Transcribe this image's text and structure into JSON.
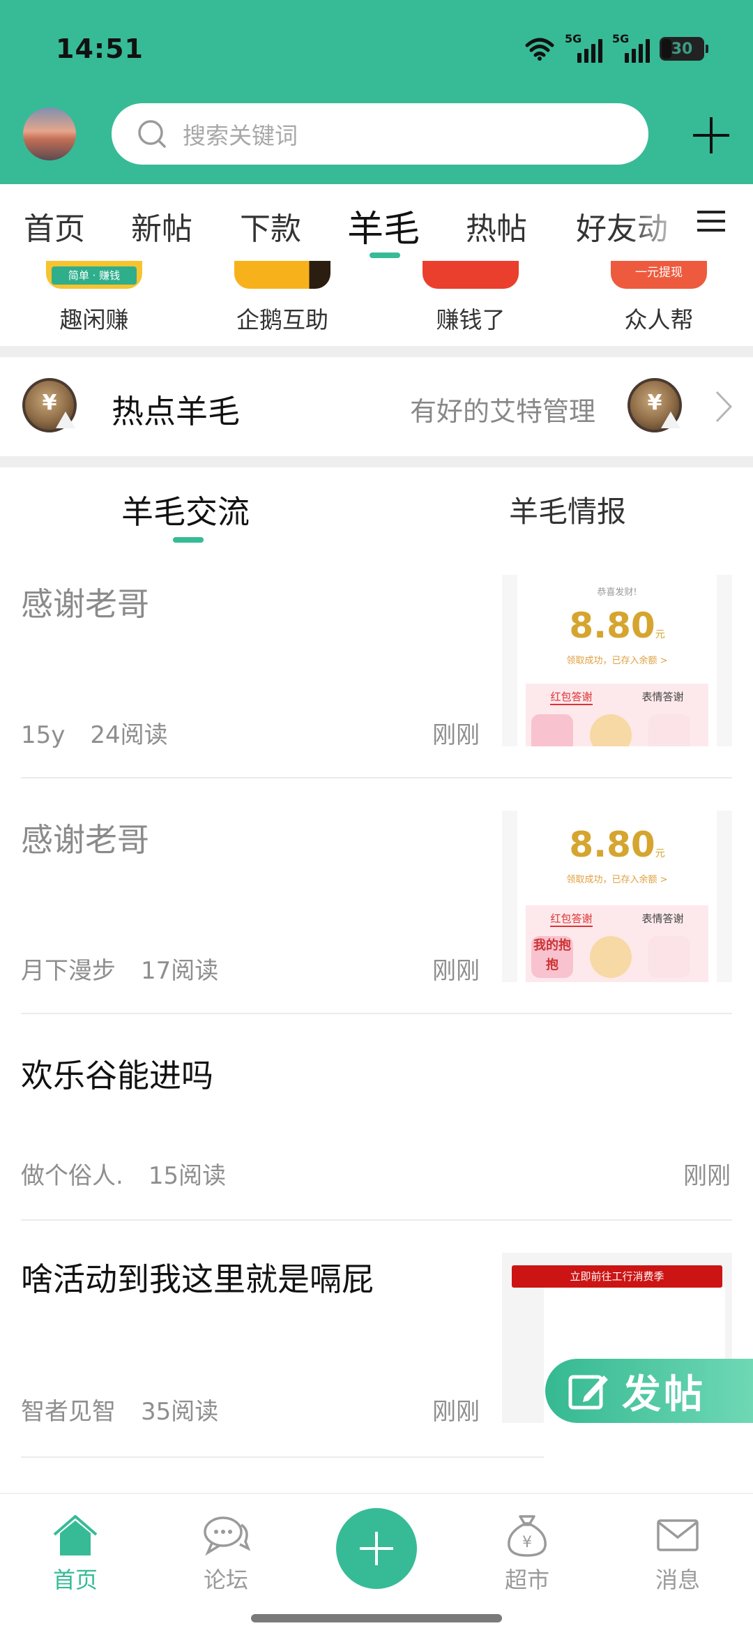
{
  "status_bar": {
    "time": "14:51",
    "net1": "5G",
    "net2": "5G",
    "battery": "30"
  },
  "header": {
    "search_placeholder": "搜索关键词"
  },
  "top_tabs": [
    "首页",
    "新帖",
    "下款",
    "羊毛",
    "热帖",
    "好友动"
  ],
  "active_top_tab": "羊毛",
  "apps": [
    {
      "label": "趣闲赚",
      "thumb_text": "简单 · 赚钱"
    },
    {
      "label": "企鹅互助",
      "thumb_text": ""
    },
    {
      "label": "赚钱了",
      "thumb_text": ""
    },
    {
      "label": "众人帮",
      "thumb_text": "一元提现"
    }
  ],
  "hot": {
    "title": "热点羊毛",
    "subtitle": "有好的艾特管理",
    "coin_symbol": "¥"
  },
  "sub_tabs": [
    "羊毛交流",
    "羊毛情报"
  ],
  "active_sub_tab": "羊毛交流",
  "posts": [
    {
      "title": "感谢老哥",
      "author": "15y",
      "reads": "24阅读",
      "time": "刚刚",
      "read": true,
      "shot": {
        "header": "恭喜发财!",
        "amount": "8.80",
        "unit": "元",
        "hint": "领取成功，已存入余额 >",
        "tab_on": "红包答谢",
        "tab_off": "表情答谢"
      }
    },
    {
      "title": "感谢老哥",
      "author": "月下漫步",
      "reads": "17阅读",
      "time": "刚刚",
      "read": true,
      "shot": {
        "amount": "8.80",
        "unit": "元",
        "hint": "领取成功，已存入余额 >",
        "tab_on": "红包答谢",
        "tab_off": "表情答谢",
        "sticker": "我的抱抱"
      }
    },
    {
      "title": "欢乐谷能进吗",
      "author": "做个俗人.",
      "reads": "15阅读",
      "time": "刚刚",
      "read": false
    },
    {
      "title": "啥活动到我这里就是嗝屁",
      "author": "智者见智",
      "reads": "35阅读",
      "time": "刚刚",
      "read": false,
      "banner": "立即前往工行消费季"
    }
  ],
  "post_button": "发帖",
  "bottom_nav": [
    {
      "label": "首页",
      "icon": "home-icon"
    },
    {
      "label": "论坛",
      "icon": "chat-bubble-icon"
    },
    {
      "label": "超市",
      "icon": "money-bag-icon"
    },
    {
      "label": "消息",
      "icon": "mail-icon"
    }
  ],
  "colors": {
    "brand": "#37bb97",
    "gold": "#d5a52f"
  }
}
